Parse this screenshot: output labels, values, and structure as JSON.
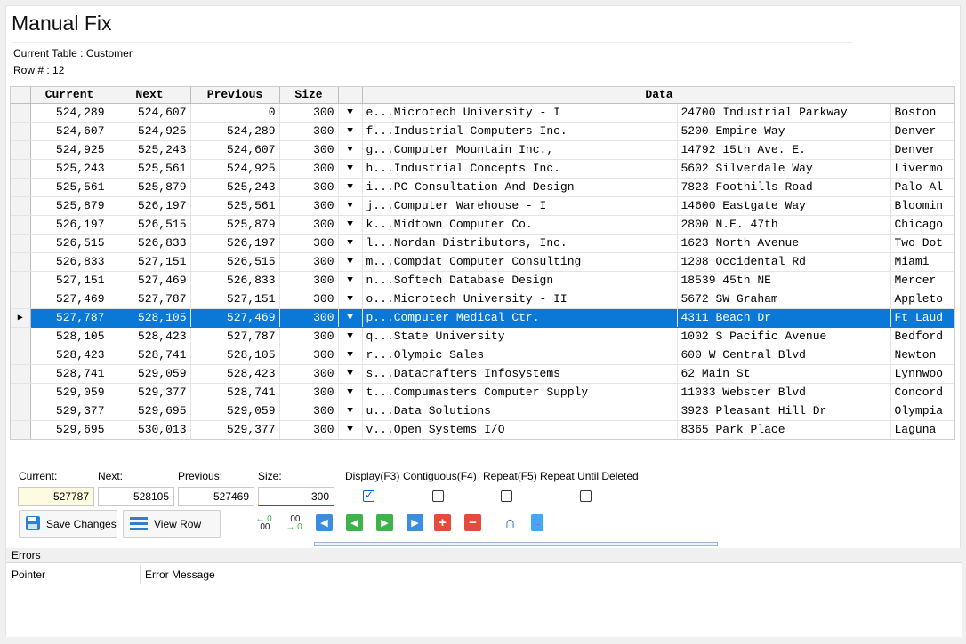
{
  "header": {
    "title": "Manual Fix",
    "current_table": "Current Table : Customer",
    "row_number": "Row # : 12"
  },
  "grid": {
    "columns": [
      "Current",
      "Next",
      "Previous",
      "Size",
      "",
      "Data"
    ],
    "selected_row": 11,
    "rows": [
      {
        "current": "524,289",
        "next": "524,607",
        "previous": "0",
        "size": "300",
        "data": "e...Microtech University - I",
        "addr": "24700 Industrial Parkway",
        "city": "Boston"
      },
      {
        "current": "524,607",
        "next": "524,925",
        "previous": "524,289",
        "size": "300",
        "data": "f...Industrial Computers Inc.",
        "addr": "5200 Empire Way",
        "city": "Denver"
      },
      {
        "current": "524,925",
        "next": "525,243",
        "previous": "524,607",
        "size": "300",
        "data": "g...Computer Mountain Inc.,",
        "addr": "14792 15th Ave. E.",
        "city": "Denver"
      },
      {
        "current": "525,243",
        "next": "525,561",
        "previous": "524,925",
        "size": "300",
        "data": "h...Industrial Concepts Inc.",
        "addr": "5602 Silverdale Way",
        "city": "Livermo"
      },
      {
        "current": "525,561",
        "next": "525,879",
        "previous": "525,243",
        "size": "300",
        "data": "i...PC Consultation And Design",
        "addr": "7823 Foothills Road",
        "city": "Palo Al"
      },
      {
        "current": "525,879",
        "next": "526,197",
        "previous": "525,561",
        "size": "300",
        "data": "j...Computer Warehouse - I",
        "addr": "14600 Eastgate Way",
        "city": "Bloomin"
      },
      {
        "current": "526,197",
        "next": "526,515",
        "previous": "525,879",
        "size": "300",
        "data": "k...Midtown Computer Co.",
        "addr": "2800 N.E. 47th",
        "city": "Chicago"
      },
      {
        "current": "526,515",
        "next": "526,833",
        "previous": "526,197",
        "size": "300",
        "data": "l...Nordan Distributors, Inc.",
        "addr": "1623 North Avenue",
        "city": "Two Dot"
      },
      {
        "current": "526,833",
        "next": "527,151",
        "previous": "526,515",
        "size": "300",
        "data": "m...Compdat Computer Consulting",
        "addr": "1208 Occidental Rd",
        "city": "Miami"
      },
      {
        "current": "527,151",
        "next": "527,469",
        "previous": "526,833",
        "size": "300",
        "data": "n...Softech Database Design",
        "addr": "18539 45th NE",
        "city": "Mercer"
      },
      {
        "current": "527,469",
        "next": "527,787",
        "previous": "527,151",
        "size": "300",
        "data": "o...Microtech University - II",
        "addr": "5672 SW Graham",
        "city": "Appleto"
      },
      {
        "current": "527,787",
        "next": "528,105",
        "previous": "527,469",
        "size": "300",
        "data": "p...Computer Medical Ctr.",
        "addr": "4311 Beach Dr",
        "city": "Ft Laud"
      },
      {
        "current": "528,105",
        "next": "528,423",
        "previous": "527,787",
        "size": "300",
        "data": "q...State University",
        "addr": "1002 S Pacific Avenue",
        "city": "Bedford"
      },
      {
        "current": "528,423",
        "next": "528,741",
        "previous": "528,105",
        "size": "300",
        "data": "r...Olympic Sales",
        "addr": "600 W Central Blvd",
        "city": "Newton"
      },
      {
        "current": "528,741",
        "next": "529,059",
        "previous": "528,423",
        "size": "300",
        "data": "s...Datacrafters Infosystems",
        "addr": "62 Main St",
        "city": "Lynnwoo"
      },
      {
        "current": "529,059",
        "next": "529,377",
        "previous": "528,741",
        "size": "300",
        "data": "t...Compumasters Computer Supply",
        "addr": "11033 Webster Blvd",
        "city": "Concord"
      },
      {
        "current": "529,377",
        "next": "529,695",
        "previous": "529,059",
        "size": "300",
        "data": "u...Data Solutions",
        "addr": "3923 Pleasant Hill Dr",
        "city": "Olympia"
      },
      {
        "current": "529,695",
        "next": "530,013",
        "previous": "529,377",
        "size": "300",
        "data": "v...Open Systems I/O",
        "addr": "8365 Park Place",
        "city": "Laguna"
      }
    ]
  },
  "form": {
    "current_label": "Current:",
    "next_label": "Next:",
    "previous_label": "Previous:",
    "size_label": "Size:",
    "current_value": "527787",
    "next_value": "528105",
    "previous_value": "527469",
    "size_value": "300",
    "display_label": "Display(F3)",
    "contiguous_label": "Contiguous(F4)",
    "repeat_label": "Repeat(F5)",
    "repeat_until_label": "Repeat Until Deleted",
    "display_checked": true
  },
  "toolbar": {
    "save_label": "Save Changes",
    "view_label": "View Row"
  },
  "errors": {
    "title": "Errors",
    "col_pointer": "Pointer",
    "col_message": "Error Message"
  }
}
